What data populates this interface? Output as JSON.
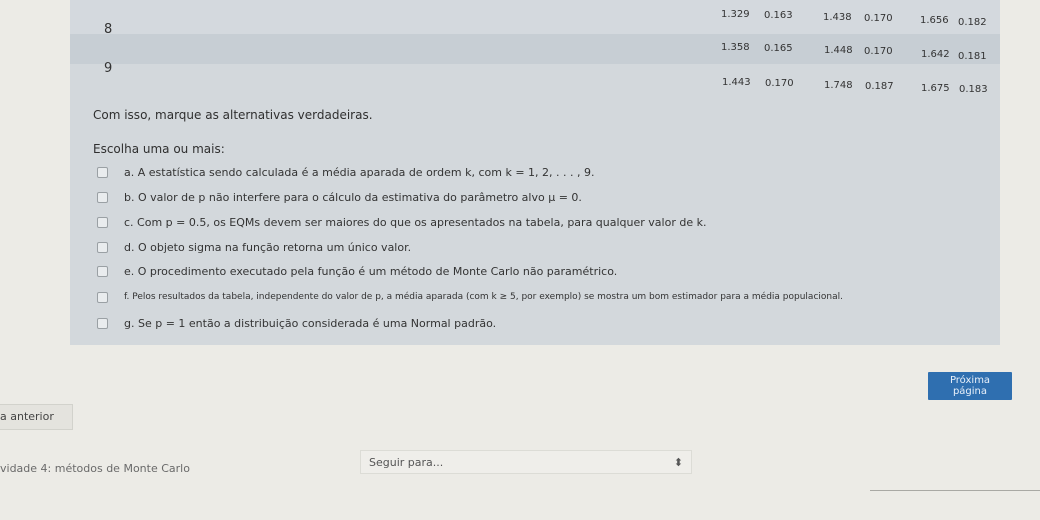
{
  "table": {
    "rows": [
      {
        "label": "8",
        "values": [
          "1.329",
          "0.163",
          "1.438",
          "0.170",
          "1.656",
          "0.182"
        ]
      },
      {
        "label": "",
        "values": [
          "1.358",
          "0.165",
          "1.448",
          "0.170",
          "1.642",
          "0.181"
        ]
      },
      {
        "label": "9",
        "values": [
          "1.443",
          "0.170",
          "1.748",
          "0.187",
          "1.675",
          "0.183"
        ]
      }
    ]
  },
  "question": {
    "prompt": "Com isso, marque as alternativas verdadeiras.",
    "choose": "Escolha uma ou mais:",
    "options": [
      "a. A estatística sendo calculada é a média aparada de ordem k, com k = 1, 2, . . . , 9.",
      "b. O valor de p não interfere para o cálculo da estimativa do parâmetro alvo μ = 0.",
      "c. Com p = 0.5, os EQMs devem ser maiores do que os apresentados na tabela, para qualquer valor de k.",
      "d. O objeto sigma na função retorna um único valor.",
      "e. O procedimento executado pela função é um método de Monte Carlo não paramétrico.",
      "f. Pelos resultados da tabela, independente do valor de p, a média aparada (com k ≥ 5, por exemplo) se mostra um bom estimador para a média populacional.",
      "g. Se p = 1 então a distribuição considerada é uma Normal padrão."
    ]
  },
  "nav": {
    "next_label": "Próxima página",
    "prev_label": "a anterior",
    "activity_label": "vidade 4: métodos de Monte Carlo",
    "jump_placeholder": "Seguir para...",
    "jump_arrow": "⬍"
  }
}
